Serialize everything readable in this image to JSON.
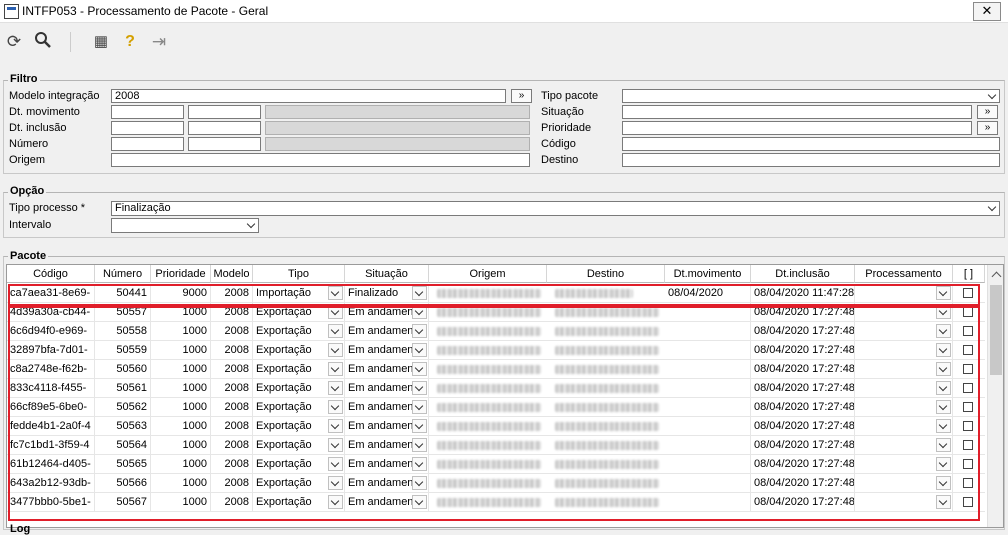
{
  "window": {
    "title": "INTFP053 - Processamento de Pacote - Geral",
    "close_glyph": "✕"
  },
  "toolbar": [
    {
      "name": "refresh-icon",
      "glyph": "⟳"
    },
    {
      "name": "search-icon",
      "glyph": "🔍"
    },
    {
      "name": "calculator-icon",
      "glyph": "▦"
    },
    {
      "name": "help-icon",
      "glyph": "?"
    },
    {
      "name": "exit-icon",
      "glyph": "⇥"
    }
  ],
  "filtro": {
    "title": "Filtro",
    "modelo_label": "Modelo integração",
    "modelo_value": "2008",
    "dt_movimento_label": "Dt. movimento",
    "dt_inclusao_label": "Dt. inclusão",
    "numero_label": "Número",
    "origem_label": "Origem",
    "tipo_pacote_label": "Tipo pacote",
    "situacao_label": "Situação",
    "prioridade_label": "Prioridade",
    "codigo_label": "Código",
    "destino_label": "Destino",
    "lookup_glyph": "»"
  },
  "opcao": {
    "title": "Opção",
    "tipo_processo_label": "Tipo processo *",
    "tipo_processo_value": "Finalização",
    "intervalo_label": "Intervalo"
  },
  "pacote": {
    "title": "Pacote",
    "columns": [
      "Código",
      "Número",
      "Prioridade",
      "Modelo",
      "Tipo",
      "Situação",
      "Origem",
      "Destino",
      "Dt.movimento",
      "Dt.inclusão",
      "Processamento",
      "[ ]"
    ],
    "rows": [
      {
        "codigo": "ca7aea31-8e69-",
        "numero": "50441",
        "prioridade": "9000",
        "modelo": "2008",
        "tipo": "Importação",
        "situacao": "Finalizado",
        "dt_mov": "08/04/2020",
        "dt_inc": "08/04/2020 11:47:28"
      },
      {
        "codigo": "4d39a30a-cb44-",
        "numero": "50557",
        "prioridade": "1000",
        "modelo": "2008",
        "tipo": "Exportação",
        "situacao": "Em andamen",
        "dt_mov": "",
        "dt_inc": "08/04/2020 17:27:48"
      },
      {
        "codigo": "6c6d94f0-e969-",
        "numero": "50558",
        "prioridade": "1000",
        "modelo": "2008",
        "tipo": "Exportação",
        "situacao": "Em andamen",
        "dt_mov": "",
        "dt_inc": "08/04/2020 17:27:48"
      },
      {
        "codigo": "32897bfa-7d01-",
        "numero": "50559",
        "prioridade": "1000",
        "modelo": "2008",
        "tipo": "Exportação",
        "situacao": "Em andamen",
        "dt_mov": "",
        "dt_inc": "08/04/2020 17:27:48"
      },
      {
        "codigo": "c8a2748e-f62b-",
        "numero": "50560",
        "prioridade": "1000",
        "modelo": "2008",
        "tipo": "Exportação",
        "situacao": "Em andamen",
        "dt_mov": "",
        "dt_inc": "08/04/2020 17:27:48"
      },
      {
        "codigo": "833c4118-f455-",
        "numero": "50561",
        "prioridade": "1000",
        "modelo": "2008",
        "tipo": "Exportação",
        "situacao": "Em andamen",
        "dt_mov": "",
        "dt_inc": "08/04/2020 17:27:48"
      },
      {
        "codigo": "66cf89e5-6be0-",
        "numero": "50562",
        "prioridade": "1000",
        "modelo": "2008",
        "tipo": "Exportação",
        "situacao": "Em andamen",
        "dt_mov": "",
        "dt_inc": "08/04/2020 17:27:48"
      },
      {
        "codigo": "fedde4b1-2a0f-4",
        "numero": "50563",
        "prioridade": "1000",
        "modelo": "2008",
        "tipo": "Exportação",
        "situacao": "Em andamen",
        "dt_mov": "",
        "dt_inc": "08/04/2020 17:27:48"
      },
      {
        "codigo": "fc7c1bd1-3f59-4",
        "numero": "50564",
        "prioridade": "1000",
        "modelo": "2008",
        "tipo": "Exportação",
        "situacao": "Em andamen",
        "dt_mov": "",
        "dt_inc": "08/04/2020 17:27:48"
      },
      {
        "codigo": "61b12464-d405-",
        "numero": "50565",
        "prioridade": "1000",
        "modelo": "2008",
        "tipo": "Exportação",
        "situacao": "Em andamen",
        "dt_mov": "",
        "dt_inc": "08/04/2020 17:27:48"
      },
      {
        "codigo": "643a2b12-93db-",
        "numero": "50566",
        "prioridade": "1000",
        "modelo": "2008",
        "tipo": "Exportação",
        "situacao": "Em andamen",
        "dt_mov": "",
        "dt_inc": "08/04/2020 17:27:48"
      },
      {
        "codigo": "3477bbb0-5be1-",
        "numero": "50567",
        "prioridade": "1000",
        "modelo": "2008",
        "tipo": "Exportação",
        "situacao": "Em andamen",
        "dt_mov": "",
        "dt_inc": "08/04/2020 17:27:48"
      }
    ],
    "highlight_color": "#e01e2a"
  },
  "log": {
    "title": "Log"
  }
}
